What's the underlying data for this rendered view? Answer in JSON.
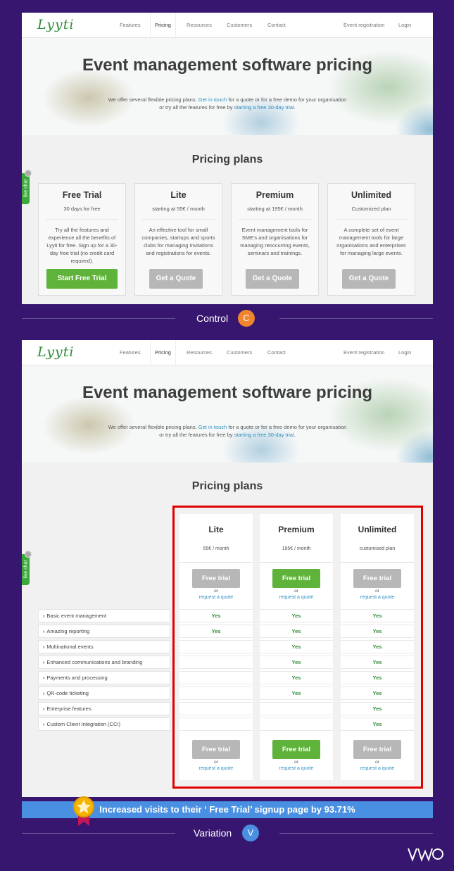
{
  "nav": {
    "logo": "Lyyti",
    "items": [
      "Features",
      "Pricing",
      "Resources",
      "Customers",
      "Contact"
    ],
    "right": [
      "Event registration",
      "Login"
    ]
  },
  "hero": {
    "title": "Event management software pricing",
    "sub_before": "We offer several flexible pricing plans. ",
    "link1": "Get in touch",
    "sub_middle": " for a quote or for a free demo for your organisation or try all the features for free by ",
    "link2": "starting a free 30-day trial",
    "sub_after": "."
  },
  "livechat": "live chat",
  "section_title": "Pricing plans",
  "control": {
    "cards": [
      {
        "name": "Free Trial",
        "price": "30 days for free",
        "desc": "Try all the features and experience all the benefits of Lyyti for free. Sign up for a 30-day free trial (no credit card required).",
        "button": "Start Free Trial"
      },
      {
        "name": "Lite",
        "price": "starting at 55€ / month",
        "desc": "An effective tool for small companies, startups and sports clubs for managing invitations and registrations for events.",
        "button": "Get a Quote"
      },
      {
        "name": "Premium",
        "price": "starting at 195€ / month",
        "desc": "Event management tools for SME's and organisations for managing reoccurring events, seminars and trainings.",
        "button": "Get a Quote"
      },
      {
        "name": "Unlimited",
        "price": "Customized plan",
        "desc": "A complete set of event management tools for large organisations and enterprises for managing large events.",
        "button": "Get a Quote"
      }
    ],
    "caption": "Control",
    "badge": "C"
  },
  "variation": {
    "plans": [
      {
        "name": "Lite",
        "price": "55€ / month",
        "button": "Free trial",
        "or": "or",
        "quote": "request a quote"
      },
      {
        "name": "Premium",
        "price": "195€ / month",
        "button": "Free trial",
        "or": "or",
        "quote": "request a quote"
      },
      {
        "name": "Unlimited",
        "price": "customised plan",
        "button": "Free trial",
        "or": "or",
        "quote": "request a quote"
      }
    ],
    "features": [
      {
        "label": "Basic event management",
        "values": [
          "Yes",
          "Yes",
          "Yes"
        ]
      },
      {
        "label": "Amazing reporting",
        "values": [
          "Yes",
          "Yes",
          "Yes"
        ]
      },
      {
        "label": "Multinational events",
        "values": [
          "",
          "Yes",
          "Yes"
        ]
      },
      {
        "label": "Enhanced communications and branding",
        "values": [
          "",
          "Yes",
          "Yes"
        ]
      },
      {
        "label": "Payments and processing",
        "values": [
          "",
          "Yes",
          "Yes"
        ]
      },
      {
        "label": "QR-code ticketing",
        "values": [
          "",
          "Yes",
          "Yes"
        ]
      },
      {
        "label": "Enterprise features",
        "values": [
          "",
          "",
          "Yes"
        ]
      },
      {
        "label": "Custom Client Integration (CCI)",
        "values": [
          "",
          "",
          "Yes"
        ]
      }
    ],
    "caption": "Variation",
    "badge": "V"
  },
  "banner": "Increased visits to their ‘ Free Trial’ signup page by 93.71%",
  "brand": "VWO",
  "colors": {
    "background": "#36166e",
    "green_button": "#5fb33a",
    "gray_button": "#b7b7b7",
    "highlight_box": "#e00000",
    "banner": "#4a90e2",
    "control_badge": "#f0852d",
    "variation_badge": "#4a90e2"
  }
}
